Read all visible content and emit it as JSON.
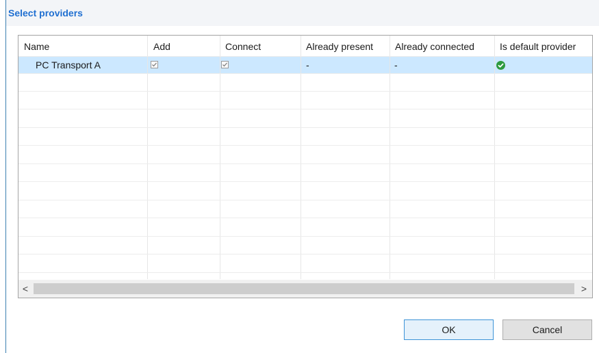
{
  "dialog": {
    "title": "Select providers"
  },
  "table": {
    "columns": [
      "Name",
      "Add",
      "Connect",
      "Already present",
      "Already connected",
      "Is default provider"
    ],
    "rows": [
      {
        "name": "PC Transport A",
        "add": true,
        "connect": true,
        "already_present": "-",
        "already_connected": "-",
        "is_default_provider": "check-circle-icon"
      }
    ],
    "selected_row_index": 0
  },
  "scrollbar": {
    "left_arrow": "<",
    "right_arrow": ">"
  },
  "buttons": {
    "ok_label": "OK",
    "cancel_label": "Cancel"
  },
  "colors": {
    "title": "#1f6fd1",
    "selected_row": "#cce8ff",
    "default_icon": "#2e9a3e",
    "ok_border": "#3c93d7"
  }
}
